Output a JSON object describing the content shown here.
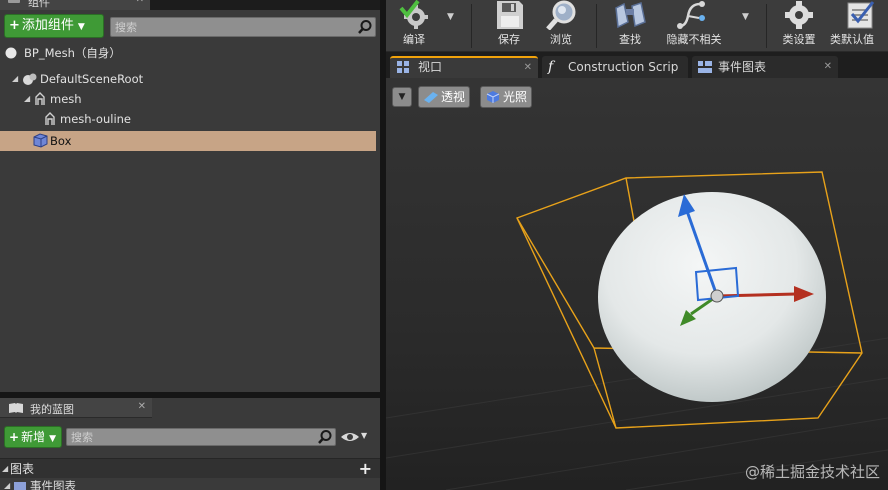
{
  "components_panel": {
    "tab_label": "组件",
    "add_button_label": "添加组件",
    "search_placeholder": "搜索",
    "self_item": "BP_Mesh（自身）",
    "tree": [
      {
        "label": "DefaultSceneRoot",
        "icon": "scene-root-icon"
      },
      {
        "label": "mesh",
        "icon": "static-mesh-icon"
      },
      {
        "label": "mesh-ouline",
        "icon": "static-mesh-icon"
      },
      {
        "label": "Box",
        "icon": "box-collision-icon",
        "selected": true
      }
    ]
  },
  "my_blueprint": {
    "tab_label": "我的蓝图",
    "add_button_label": "新增",
    "search_placeholder": "搜索",
    "graphs_label": "图表",
    "event_graph_label": "事件图表"
  },
  "toolbar": {
    "buttons": [
      {
        "label": "编译",
        "icon": "compile-gear-check-icon"
      },
      {
        "label": "保存",
        "icon": "save-floppy-icon"
      },
      {
        "label": "浏览",
        "icon": "browse-magnifier-icon"
      },
      {
        "label": "查找",
        "icon": "find-binoculars-icon"
      },
      {
        "label": "隐藏不相关",
        "icon": "hide-unrelated-icon"
      },
      {
        "label": "类设置",
        "icon": "class-settings-gear-icon"
      },
      {
        "label": "类默认值",
        "icon": "class-defaults-icon"
      }
    ]
  },
  "doc_tabs": [
    {
      "label": "视口",
      "active": true,
      "icon": "viewport-icon"
    },
    {
      "label": "Construction Scrip",
      "active": false,
      "icon": "function-icon"
    },
    {
      "label": "事件图表",
      "active": false,
      "icon": "event-graph-icon"
    }
  ],
  "viewport": {
    "perspective_label": "透视",
    "lighting_label": "光照"
  },
  "watermark": "@稀土掘金技术社区",
  "colors": {
    "selection": "#c7a486",
    "green_button": "#3f9a36",
    "active_tab_accent": "#f2a30b",
    "bounds_box": "#e8a21a"
  }
}
